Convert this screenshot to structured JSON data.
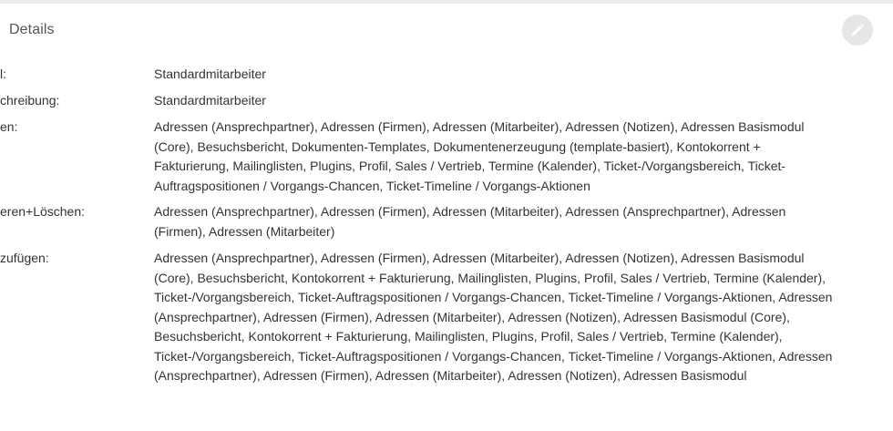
{
  "panel": {
    "title": "Details",
    "edit_icon": "pencil-icon"
  },
  "rows": [
    {
      "label": "l:",
      "value": "Standardmitarbeiter"
    },
    {
      "label": "chreibung:",
      "value": "Standardmitarbeiter"
    },
    {
      "label": "en:",
      "value": "Adressen (Ansprechpartner), Adressen (Firmen), Adressen (Mitarbeiter), Adressen (Notizen), Adressen Basismodul (Core), Besuchsbericht, Dokumenten-Templates, Dokumentenerzeugung (template-basiert), Kontokorrent + Fakturierung, Mailinglisten, Plugins, Profil, Sales / Vertrieb, Termine (Kalender), Ticket-/Vorgangsbereich, Ticket-Auftragspositionen / Vorgangs-Chancen, Ticket-Timeline / Vorgangs-Aktionen"
    },
    {
      "label": "eren+Löschen:",
      "value": "Adressen (Ansprechpartner), Adressen (Firmen), Adressen (Mitarbeiter), Adressen (Ansprechpartner), Adressen (Firmen), Adressen (Mitarbeiter)"
    },
    {
      "label": "zufügen:",
      "value": "Adressen (Ansprechpartner), Adressen (Firmen), Adressen (Mitarbeiter), Adressen (Notizen), Adressen Basismodul (Core), Besuchsbericht, Kontokorrent + Fakturierung, Mailinglisten, Plugins, Profil, Sales / Vertrieb, Termine (Kalender), Ticket-/Vorgangsbereich, Ticket-Auftragspositionen / Vorgangs-Chancen, Ticket-Timeline / Vorgangs-Aktionen, Adressen (Ansprechpartner), Adressen (Firmen), Adressen (Mitarbeiter), Adressen (Notizen), Adressen Basismodul (Core), Besuchsbericht, Kontokorrent + Fakturierung, Mailinglisten, Plugins, Profil, Sales / Vertrieb, Termine (Kalender), Ticket-/Vorgangsbereich, Ticket-Auftragspositionen / Vorgangs-Chancen, Ticket-Timeline / Vorgangs-Aktionen, Adressen (Ansprechpartner), Adressen (Firmen), Adressen (Mitarbeiter), Adressen (Notizen), Adressen Basismodul"
    }
  ]
}
